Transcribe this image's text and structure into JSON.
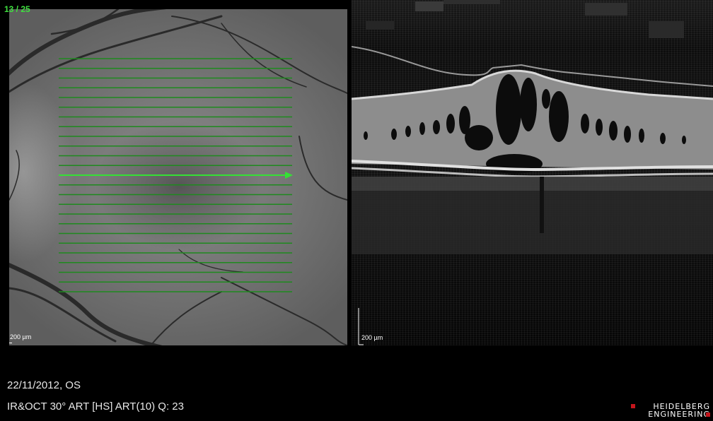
{
  "viewer": {
    "slice_counter": "13 / 25",
    "scan_count": 25,
    "selected_scan": 13,
    "line_color": "#1e8a1e",
    "selected_line_color": "#35e035"
  },
  "fundus": {
    "scale_label": "200 µm"
  },
  "bscan": {
    "scale_label": "200 µm"
  },
  "info": {
    "date_eye": "22/11/2012, OS",
    "acquisition": "IR&OCT 30° ART [HS] ART(10) Q: 23"
  },
  "logo": {
    "line1": "HEIDELBERG",
    "line2": "ENGINEERING",
    "accent_color": "#c4151c"
  }
}
